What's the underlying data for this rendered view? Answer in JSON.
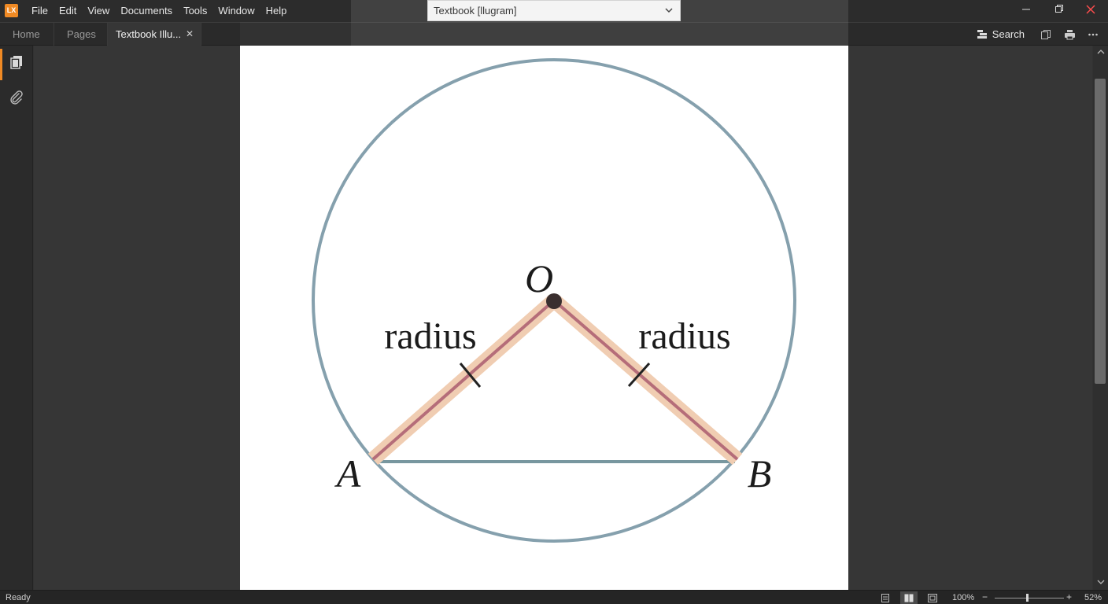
{
  "app": {
    "logo_text": "LX",
    "accent_color": "#f08a24"
  },
  "menu": {
    "items": [
      "File",
      "Edit",
      "View",
      "Documents",
      "Tools",
      "Window",
      "Help"
    ]
  },
  "document_selector": {
    "value": "Textbook [llugram]"
  },
  "tabs": [
    {
      "label": "Home",
      "active": false
    },
    {
      "label": "Pages",
      "active": false
    },
    {
      "label": "Textbook Illu...",
      "active": true
    }
  ],
  "toolbar": {
    "search_label": "Search"
  },
  "diagram": {
    "center_label": "O",
    "point_a_label": "A",
    "point_b_label": "B",
    "left_radius_label": "radius",
    "right_radius_label": "radius",
    "colors": {
      "circle": "#85a0ad",
      "chord": "#78979f",
      "radius_line": "#b56d79",
      "radius_highlight": "#f0cdb2",
      "center_point": "#3a2f2f",
      "tick": "#222222"
    }
  },
  "status": {
    "text": "Ready",
    "zoom_fit": "100%",
    "zoom_level": "52%",
    "zoom_fraction": 0.47
  }
}
